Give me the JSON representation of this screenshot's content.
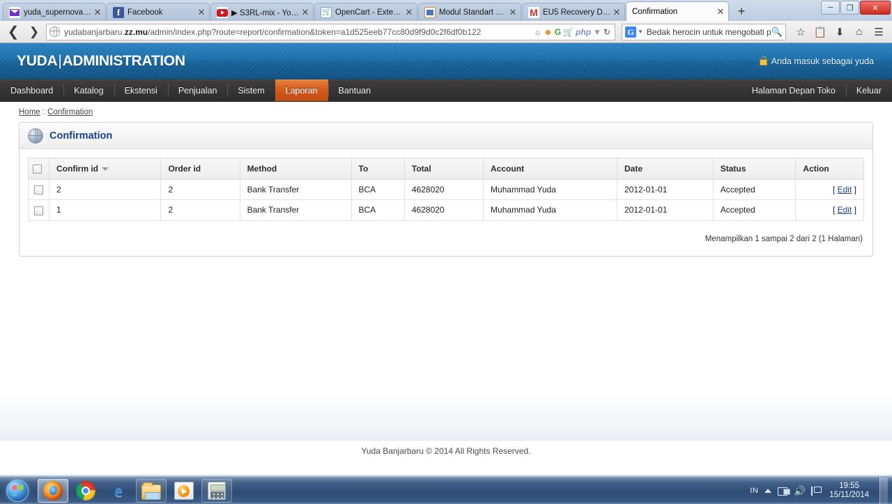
{
  "browser": {
    "tabs": [
      {
        "title": "yuda_supernova - ...",
        "favicon": "mail-icon",
        "active": false
      },
      {
        "title": "Facebook",
        "favicon": "facebook-icon",
        "active": false
      },
      {
        "title": "▶ S3RL-mix - You...",
        "favicon": "youtube-icon",
        "active": false
      },
      {
        "title": "OpenCart - Extensi...",
        "favicon": "opencart-icon",
        "active": false
      },
      {
        "title": "Modul Standart O...",
        "favicon": "module-icon",
        "active": false
      },
      {
        "title": "EU5 Recovery Deta...",
        "favicon": "gmail-icon",
        "active": false
      },
      {
        "title": "Confirmation",
        "favicon": "none",
        "active": true
      }
    ],
    "new_tab_label": "+",
    "window_controls": {
      "minimize": "–",
      "maximize": "❐",
      "close": "✕"
    },
    "nav": {
      "back_icon": "back-arrow-icon",
      "forward_icon": "forward-arrow-icon",
      "url_prefix": "yudabanjarbaru.",
      "url_domain": "zz.mu",
      "url_suffix": "/admin/index.php?route=report/confirmation&token=a1d525eeb77cc80d9f9d0c2f6df0b122",
      "toolbar_icons": [
        "stumbleupon-icon",
        "smiley-icon",
        "google-icon",
        "cart-icon",
        "php-icon",
        "dropdown-caret-icon",
        "reload-icon"
      ],
      "right_icons": [
        "bookmark-star-icon",
        "reading-list-icon",
        "downloads-icon",
        "home-icon",
        "menu-icon"
      ]
    },
    "search": {
      "engine": "G",
      "query": "Bedak herocin untuk mengobati panu",
      "magnifier_icon": "search-icon"
    }
  },
  "admin": {
    "logo_left": "YUDA",
    "logo_sep": "|",
    "logo_right": "ADMINISTRATION",
    "user_text": "Anda masuk sebagai yuda",
    "lock_icon": "lock-icon",
    "nav_items": [
      {
        "label": "Dashboard",
        "active": false
      },
      {
        "label": "Katalog",
        "active": false
      },
      {
        "label": "Ekstensi",
        "active": false
      },
      {
        "label": "Penjualan",
        "active": false
      },
      {
        "label": "Sistem",
        "active": false
      },
      {
        "label": "Laporan",
        "active": true
      },
      {
        "label": "Bantuan",
        "active": false
      }
    ],
    "nav_right": [
      {
        "label": "Halaman Depan Toko"
      },
      {
        "label": "Keluar"
      }
    ],
    "breadcrumb": {
      "home": "Home",
      "separator": "::",
      "current": "Confirmation"
    },
    "panel": {
      "title": "Confirmation",
      "icon": "globe-icon"
    },
    "table": {
      "columns": [
        "Confirm id",
        "Order id",
        "Method",
        "To",
        "Total",
        "Account",
        "Date",
        "Status",
        "Action"
      ],
      "sorted_column": "Confirm id",
      "sort_icon": "sort-desc-caret-icon",
      "rows": [
        {
          "confirm_id": "2",
          "order_id": "2",
          "method": "Bank Transfer",
          "to": "BCA",
          "total": "4628020",
          "account": "Muhammad Yuda",
          "date": "2012-01-01",
          "status": "Accepted",
          "action_open": "[",
          "action_label": "Edit",
          "action_close": "]"
        },
        {
          "confirm_id": "1",
          "order_id": "2",
          "method": "Bank Transfer",
          "to": "BCA",
          "total": "4628020",
          "account": "Muhammad Yuda",
          "date": "2012-01-01",
          "status": "Accepted",
          "action_open": "[",
          "action_label": "Edit",
          "action_close": "]"
        }
      ]
    },
    "pagination": "Menampilkan 1 sampai 2 dari 2 (1 Halaman)",
    "footer": "Yuda Banjarbaru © 2014 All Rights Reserved."
  },
  "taskbar": {
    "start_icon": "windows-start-icon",
    "buttons": [
      {
        "icon": "firefox-icon",
        "state": "active"
      },
      {
        "icon": "chrome-icon",
        "state": "pinned"
      },
      {
        "icon": "internet-explorer-icon",
        "state": "pinned"
      },
      {
        "icon": "file-explorer-icon",
        "state": "framed"
      },
      {
        "icon": "media-player-icon",
        "state": "framed"
      },
      {
        "icon": "calculator-icon",
        "state": "framed"
      }
    ],
    "tray": {
      "language": "IN",
      "show_hidden_icon": "up-caret-icon",
      "network_icon": "network-icon",
      "volume_icon": "volume-icon",
      "action_center_icon": "flag-icon",
      "time": "19:55",
      "date": "15/11/2014"
    }
  },
  "colors": {
    "header_blue": "#1b6ea8",
    "nav_dark": "#2c2c2c",
    "active_orange": "#d1561a",
    "panel_title_blue": "#1a3f8f",
    "link_blue": "#1a3f8f"
  }
}
